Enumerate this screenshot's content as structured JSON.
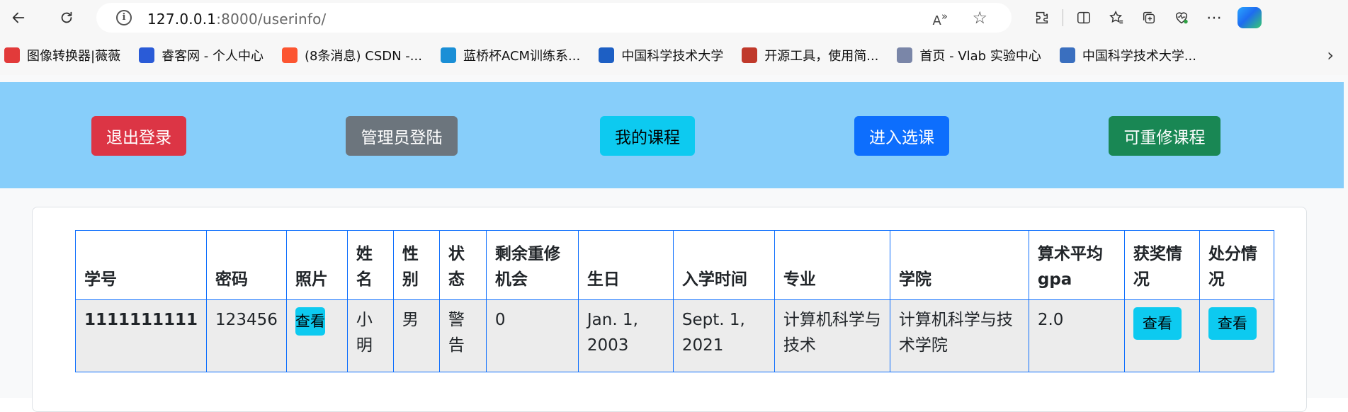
{
  "browser": {
    "url_host": "127.0.0.1",
    "url_rest": ":8000/userinfo/"
  },
  "bookmarks": [
    {
      "label": "图像转换器|薇薇",
      "color": "#e23a3a"
    },
    {
      "label": "睿客网 - 个人中心",
      "color": "#2a5bd7"
    },
    {
      "label": "(8条消息) CSDN -...",
      "color": "#fc5531"
    },
    {
      "label": "蓝桥杯ACM训练系...",
      "color": "#1a8fd6"
    },
    {
      "label": "中国科学技术大学",
      "color": "#1d5fc4"
    },
    {
      "label": "开源工具，使用简...",
      "color": "#c0392b"
    },
    {
      "label": "首页 - Vlab 实验中心",
      "color": "#7a86a8"
    },
    {
      "label": "中国科学技术大学...",
      "color": "#3a6fbf"
    }
  ],
  "nav": {
    "logout": "退出登录",
    "admin_login": "管理员登陆",
    "my_courses": "我的课程",
    "enter_selection": "进入选课",
    "retake_courses": "可重修课程"
  },
  "table": {
    "headers": [
      "学号",
      "密码",
      "照片",
      "姓名",
      "性别",
      "状态",
      "剩余重修机会",
      "生日",
      "入学时间",
      "专业",
      "学院",
      "算术平均gpa",
      "获奖情况",
      "处分情况"
    ],
    "row": {
      "student_id": "1111111111",
      "password": "123456",
      "photo_button": "查看",
      "name": "小明",
      "gender": "男",
      "status": "警告",
      "retake_chances": "0",
      "birthday": "Jan. 1, 2003",
      "enroll_date": "Sept. 1, 2021",
      "major": "计算机科学与技术",
      "college": "计算机科学与技术学院",
      "gpa": "2.0",
      "awards_button": "查看",
      "penalty_button": "查看"
    }
  }
}
